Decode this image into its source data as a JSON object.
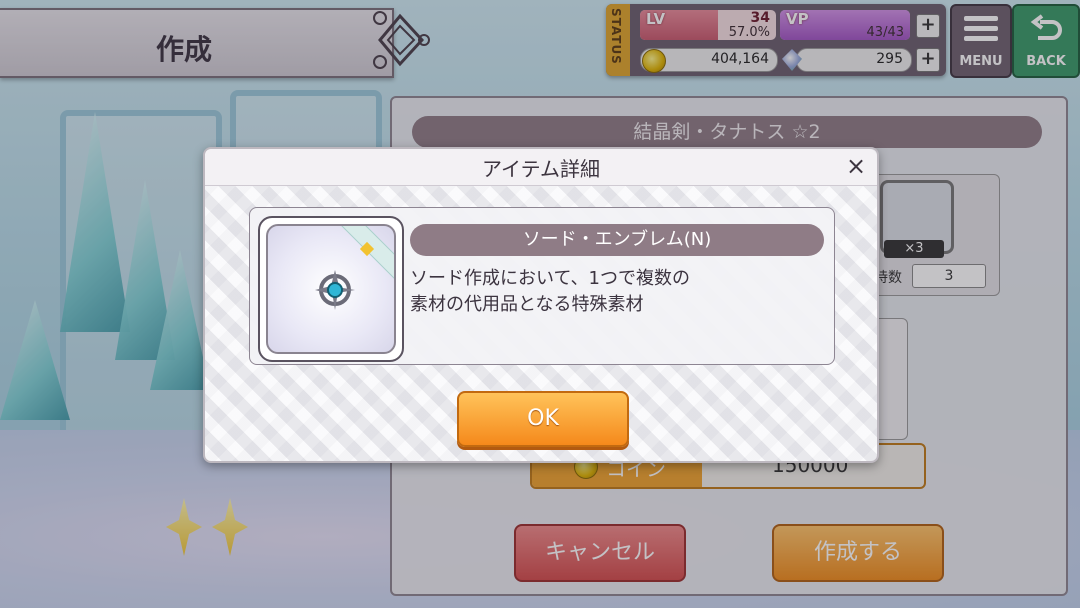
{
  "header": {
    "title": "作成"
  },
  "status": {
    "tab_label": "STATUS",
    "lv_label": "LV",
    "lv_value": "34",
    "lv_percent": "57.0%",
    "lv_progress": 0.57,
    "vp_label": "VP",
    "vp_value": "43/43",
    "vp_progress": 1.0,
    "coins": "404,164",
    "gems": "295",
    "plus_label": "+"
  },
  "nav": {
    "menu_label": "MENU",
    "back_label": "BACK"
  },
  "background_panel": {
    "weapon_name": "結晶剣・タナトス ☆2",
    "material_count": "×3",
    "owned_label": "持数",
    "owned_value": "3",
    "cost_label": "コイン",
    "cost_value": "150000",
    "cancel_label": "キャンセル",
    "create_label": "作成する"
  },
  "modal": {
    "title": "アイテム詳細",
    "close_label": "×",
    "item_name": "ソード・エンブレム(N)",
    "description_line1": "ソード作成において、1つで複数の",
    "description_line2": "素材の代用品となる特殊素材",
    "ok_label": "OK"
  },
  "colors": {
    "accent_orange": "#f5891b",
    "name_band": "#8f7c86",
    "cancel_red": "#d44c4c"
  }
}
